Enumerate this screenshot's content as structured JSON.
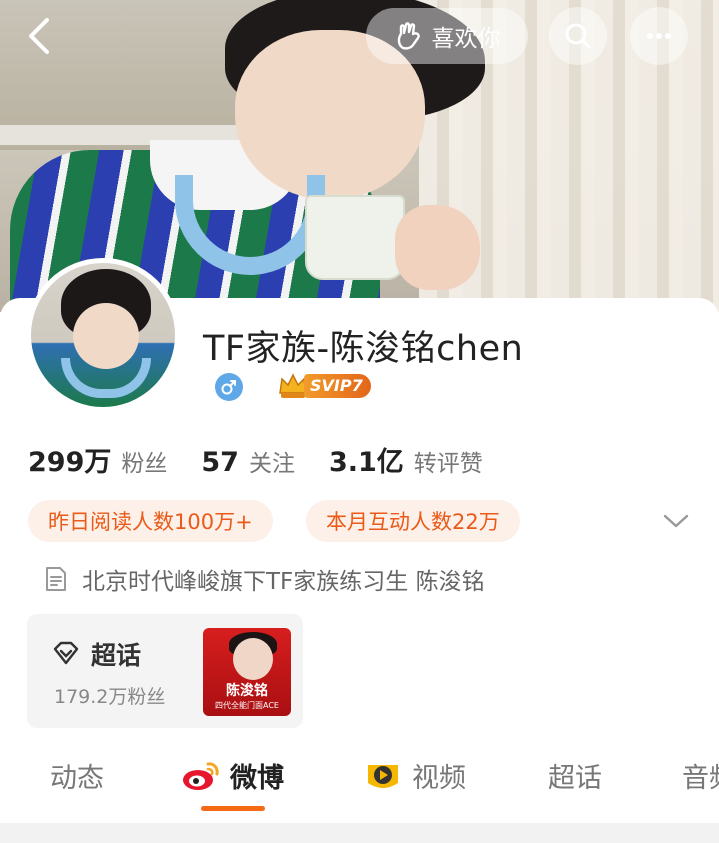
{
  "header": {
    "like_label": "喜欢你"
  },
  "profile": {
    "username": "TF家族-陈浚铭chen",
    "svip_label": "SVIP7",
    "stats": [
      {
        "num": "299万",
        "label": "粉丝"
      },
      {
        "num": "57",
        "label": "关注"
      },
      {
        "num": "3.1亿",
        "label": "转评赞"
      }
    ],
    "pills": [
      "昨日阅读人数100万+",
      "本月互动人数22万"
    ],
    "bio": "北京时代峰峻旗下TF家族练习生  陈浚铭"
  },
  "supertopic": {
    "title": "超话",
    "fans": "179.2万粉丝",
    "cover_name": "陈浚铭",
    "cover_sub": "四代全能门面ACE"
  },
  "tabs": [
    {
      "label": "动态",
      "icon": "none"
    },
    {
      "label": "微博",
      "icon": "weibo-icon",
      "active": true
    },
    {
      "label": "视频",
      "icon": "video-icon"
    },
    {
      "label": "超话",
      "icon": "none"
    },
    {
      "label": "音频",
      "icon": "none"
    }
  ],
  "colors": {
    "accent": "#f56a15",
    "pill_text": "#ea5a18",
    "pill_bg": "#fdf0e8",
    "gender_blue": "#5fa8e8"
  }
}
